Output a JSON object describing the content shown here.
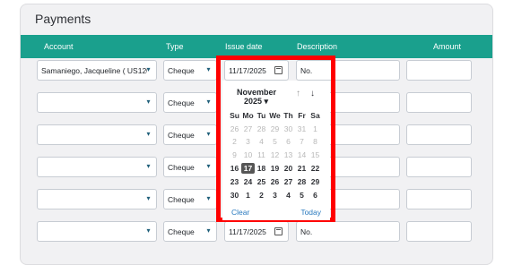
{
  "card": {
    "title": "Payments"
  },
  "table": {
    "headers": [
      "Account",
      "Type",
      "Issue date",
      "Description",
      "Amount"
    ],
    "rows": [
      {
        "account": "Samaniego, Jacqueline ( US120",
        "type": "Cheque",
        "issue_date": "11/17/2025",
        "description": "No.",
        "amount": ""
      },
      {
        "account": "",
        "type": "Cheque",
        "issue_date": "",
        "description": "",
        "amount": ""
      },
      {
        "account": "",
        "type": "Cheque",
        "issue_date": "",
        "description": "",
        "amount": ""
      },
      {
        "account": "",
        "type": "Cheque",
        "issue_date": "",
        "description": "",
        "amount": ""
      },
      {
        "account": "",
        "type": "Cheque",
        "issue_date": "",
        "description": "",
        "amount": ""
      },
      {
        "account": "",
        "type": "Cheque",
        "issue_date": "11/17/2025",
        "description": "No.",
        "amount": ""
      }
    ]
  },
  "picker": {
    "month": "November",
    "year": "2025",
    "weekdays": [
      "Su",
      "Mo",
      "Tu",
      "We",
      "Th",
      "Fr",
      "Sa"
    ],
    "weeks": [
      [
        "26",
        "27",
        "28",
        "29",
        "30",
        "31",
        "1"
      ],
      [
        "2",
        "3",
        "4",
        "5",
        "6",
        "7",
        "8"
      ],
      [
        "9",
        "10",
        "11",
        "12",
        "13",
        "14",
        "15"
      ],
      [
        "16",
        "17",
        "18",
        "19",
        "20",
        "21",
        "22"
      ],
      [
        "23",
        "24",
        "25",
        "26",
        "27",
        "28",
        "29"
      ],
      [
        "30",
        "1",
        "2",
        "3",
        "4",
        "5",
        "6"
      ]
    ],
    "clear_label": "Clear",
    "today_label": "Today"
  },
  "colors": {
    "header_teal": "#1aa08d",
    "highlight_red": "#ff0000",
    "link_blue": "#2b7bbf"
  }
}
